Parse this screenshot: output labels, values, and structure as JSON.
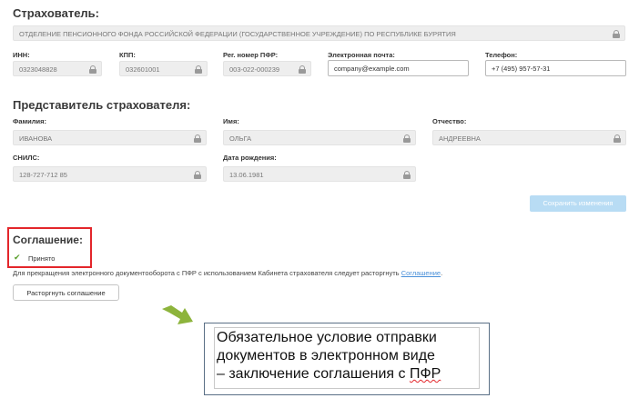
{
  "insurer": {
    "title": "Страхователь:",
    "name": "ОТДЕЛЕНИЕ ПЕНСИОННОГО ФОНДА РОССИЙСКОЙ ФЕДЕРАЦИИ (ГОСУДАРСТВЕННОЕ УЧРЕЖДЕНИЕ) ПО РЕСПУБЛИКЕ БУРЯТИЯ",
    "inn_label": "ИНН:",
    "inn": "0323048828",
    "kpp_label": "КПП:",
    "kpp": "032601001",
    "pfr_label": "Рег. номер ПФР:",
    "pfr": "003-022-000239",
    "email_label": "Электронная почта:",
    "email": "company@example.com",
    "phone_label": "Телефон:",
    "phone": "+7 (495) 957-57-31"
  },
  "representative": {
    "title": "Представитель страхователя:",
    "last_name_label": "Фамилия:",
    "last_name": "ИВАНОВА",
    "first_name_label": "Имя:",
    "first_name": "ОЛЬГА",
    "patronymic_label": "Отчество:",
    "patronymic": "АНДРЕЕВНА",
    "snils_label": "СНИЛС:",
    "snils": "128-727-712 85",
    "birth_label": "Дата рождения:",
    "birth": "13.06.1981"
  },
  "save_button": "Сохранить изменения",
  "agreement": {
    "title": "Соглашение:",
    "status": "Принято",
    "info_text": "Для прекращения электронного документооборота с ПФР с использованием Кабинета страхователя следует расторгнуть ",
    "info_link": "Соглашение",
    "info_end": ".",
    "terminate_button": "Расторгнуть соглашение"
  },
  "annotation": {
    "line1": "Обязательное условие отправки",
    "line2": "документов в электронном виде",
    "line3_start": "– заключение соглашения с ",
    "line3_end": "ПФР"
  },
  "colors": {
    "highlight_border": "#e3262b",
    "arrow": "#8db43c",
    "check": "#5aa02c",
    "link": "#4a90d9",
    "save_button_bg": "#b8dcf4"
  }
}
